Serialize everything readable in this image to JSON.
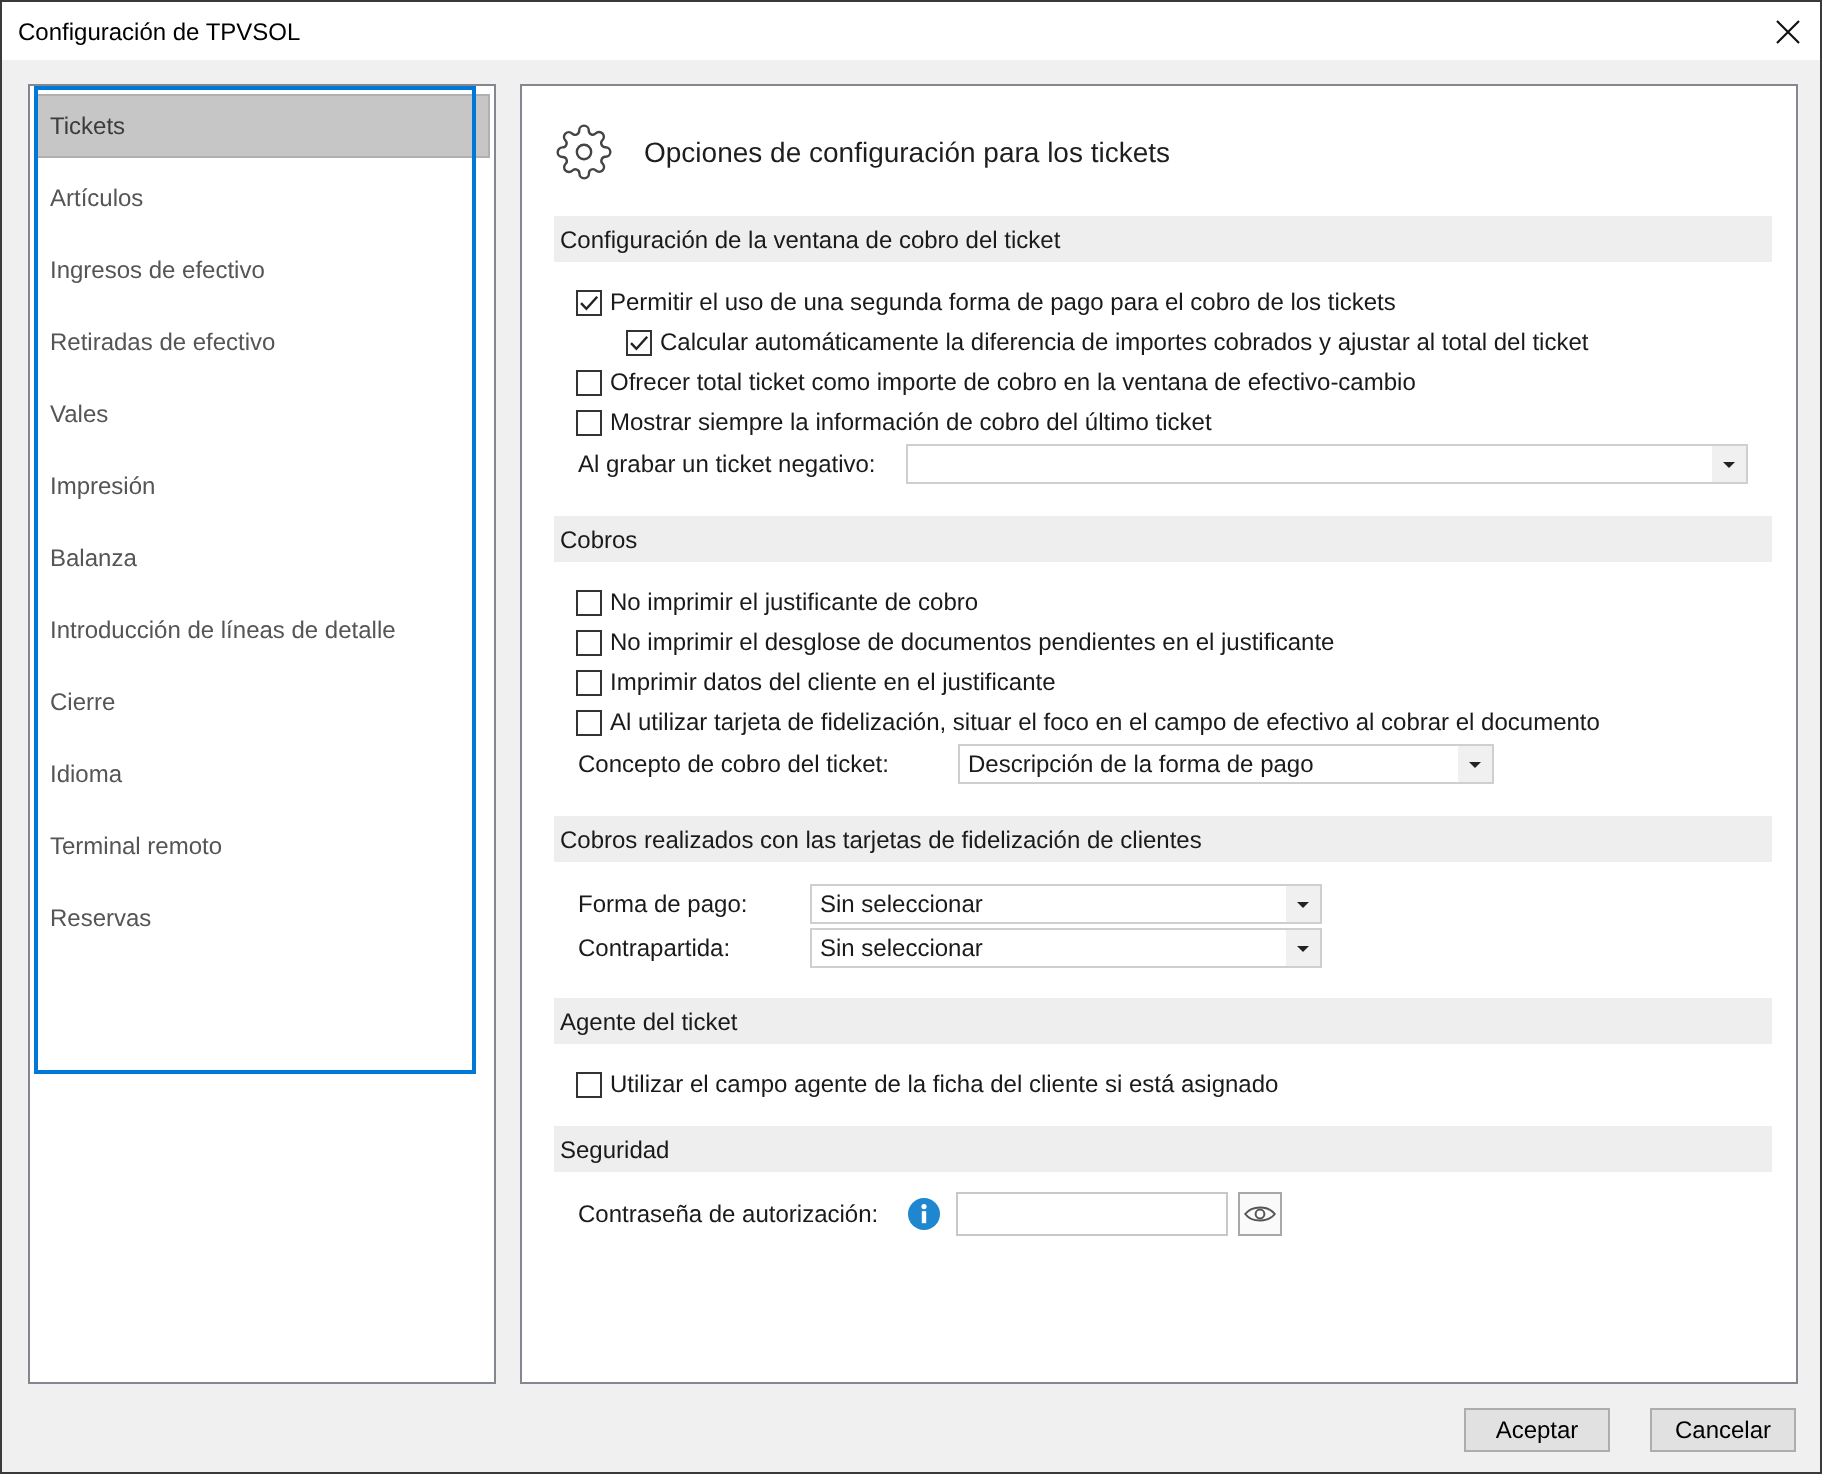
{
  "window": {
    "title": "Configuración de TPVSOL"
  },
  "sidebar": {
    "focused": true,
    "items": [
      {
        "label": "Tickets",
        "selected": true
      },
      {
        "label": "Artículos",
        "selected": false
      },
      {
        "label": "Ingresos de efectivo",
        "selected": false
      },
      {
        "label": "Retiradas de efectivo",
        "selected": false
      },
      {
        "label": "Vales",
        "selected": false
      },
      {
        "label": "Impresión",
        "selected": false
      },
      {
        "label": "Balanza",
        "selected": false
      },
      {
        "label": "Introducción de líneas de detalle",
        "selected": false
      },
      {
        "label": "Cierre",
        "selected": false
      },
      {
        "label": "Idioma",
        "selected": false
      },
      {
        "label": "Terminal remoto",
        "selected": false
      },
      {
        "label": "Reservas",
        "selected": false
      }
    ]
  },
  "content": {
    "title": "Opciones de configuración para los tickets",
    "sections": [
      {
        "title": "Configuración de la ventana de cobro del ticket",
        "rows": [
          {
            "kind": "checkbox",
            "label": "Permitir el uso de una segunda forma de pago para el cobro de los tickets",
            "checked": true,
            "children": [
              {
                "kind": "checkbox",
                "label": "Calcular automáticamente la diferencia de importes cobrados y ajustar al total del ticket",
                "checked": true
              }
            ]
          },
          {
            "kind": "checkbox",
            "label": "Ofrecer total ticket como importe de cobro en la ventana de efectivo-cambio",
            "checked": false
          },
          {
            "kind": "checkbox",
            "label": "Mostrar siempre la información de cobro del último ticket",
            "checked": false
          },
          {
            "kind": "dropdown",
            "label": "Al grabar un ticket negativo:"
          }
        ]
      },
      {
        "title": "Cobros",
        "rows": [
          {
            "kind": "checkbox",
            "label": "No imprimir el justificante de cobro",
            "checked": false
          },
          {
            "kind": "checkbox",
            "label": "No imprimir el desglose de documentos pendientes en el justificante",
            "checked": false
          },
          {
            "kind": "checkbox",
            "label": "Imprimir datos del cliente en el justificante",
            "checked": false
          },
          {
            "kind": "checkbox",
            "label": "Al utilizar tarjeta de fidelización, situar el foco en el campo de efectivo al cobrar el documento",
            "checked": false
          },
          {
            "kind": "dropdown",
            "label": "Concepto de cobro del ticket:",
            "value": "Descripción de la forma de pago"
          }
        ]
      },
      {
        "title": "Cobros realizados con las tarjetas de fidelización de clientes",
        "rows": [
          {
            "kind": "dropdown",
            "label": "Forma de pago:",
            "value": "Sin seleccionar"
          },
          {
            "kind": "dropdown",
            "label": "Contrapartida:",
            "value": "Sin seleccionar"
          }
        ]
      },
      {
        "title": "Agente del ticket",
        "rows": [
          {
            "kind": "checkbox",
            "label": "Utilizar el campo agente de la ficha del cliente si está asignado",
            "checked": false
          }
        ]
      },
      {
        "title": "Seguridad",
        "rows": [
          {
            "kind": "password",
            "label": "Contraseña de autorización:"
          }
        ]
      }
    ]
  },
  "buttons": [
    {
      "label": "Aceptar"
    },
    {
      "label": "Cancelar"
    }
  ]
}
